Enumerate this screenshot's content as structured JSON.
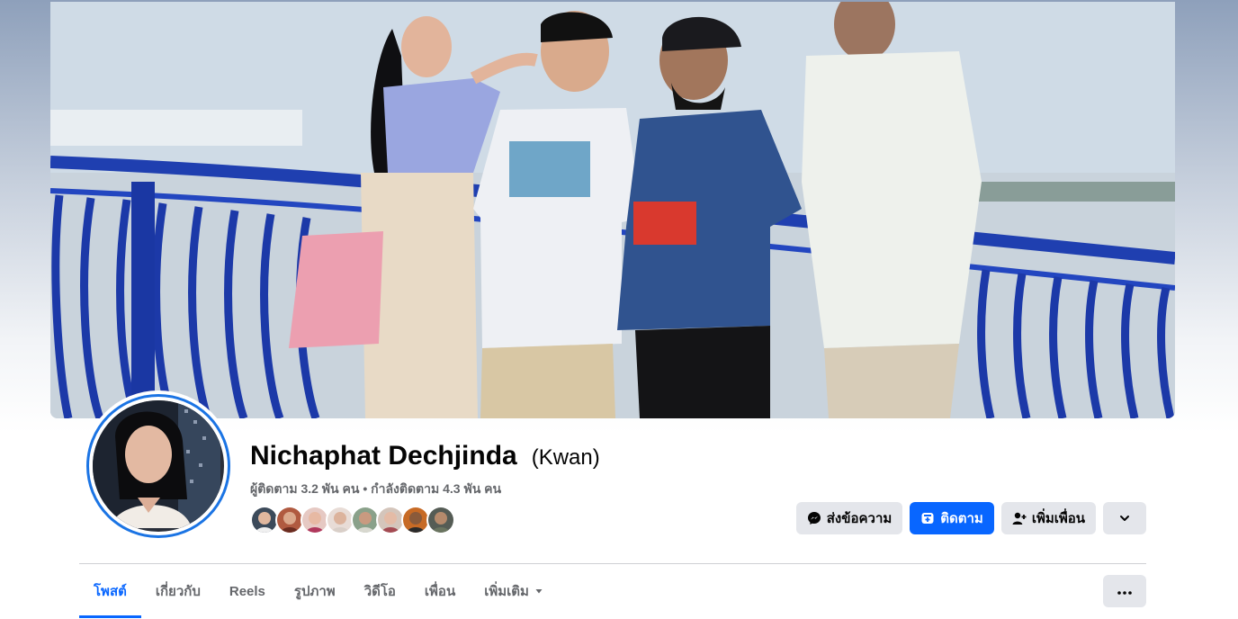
{
  "profile": {
    "name": "Nichaphat Dechjinda",
    "alt_name": "(Kwan)",
    "stats": "ผู้ติดตาม 3.2 พัน คน • กำลังติดตาม 4.3 พัน คน"
  },
  "actions": {
    "message_label": "ส่งข้อความ",
    "follow_label": "ติดตาม",
    "add_friend_label": "เพิ่มเพื่อน"
  },
  "tabs": [
    {
      "label": "โพสต์",
      "active": true
    },
    {
      "label": "เกี่ยวกับ"
    },
    {
      "label": "Reels"
    },
    {
      "label": "รูปภาพ"
    },
    {
      "label": "วิดีโอ"
    },
    {
      "label": "เพื่อน"
    },
    {
      "label": "เพิ่มเติม"
    }
  ],
  "colors": {
    "accent": "#0866ff",
    "avatar_ring": "#1b74e4",
    "secondary_text": "#65676b",
    "button_gray": "#e4e6eb"
  },
  "icons": [
    "messenger-icon",
    "follow-icon",
    "add-friend-icon",
    "chevron-down-icon",
    "more-dots-icon",
    "caret-down-icon"
  ]
}
